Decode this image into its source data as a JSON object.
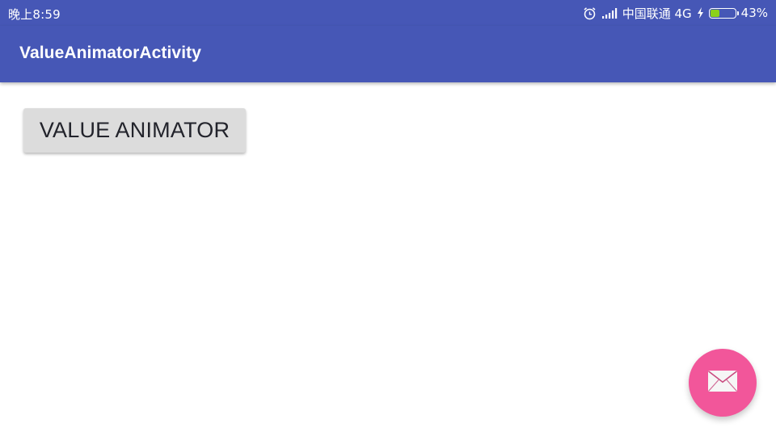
{
  "status_bar": {
    "time": "晚上8:59",
    "carrier": "中国联通 4G",
    "battery_percent": "43%",
    "battery_level": 0.43,
    "battery_color": "#8bd11b",
    "icons": [
      "alarm-clock-icon",
      "signal-strength-icon",
      "charging-bolt-icon",
      "battery-icon"
    ]
  },
  "app_bar": {
    "title": "ValueAnimatorActivity",
    "color": "#4657b6"
  },
  "main": {
    "button_label": "VALUE ANIMATOR"
  },
  "fab": {
    "icon": "mail-icon",
    "color": "#f2569a"
  }
}
